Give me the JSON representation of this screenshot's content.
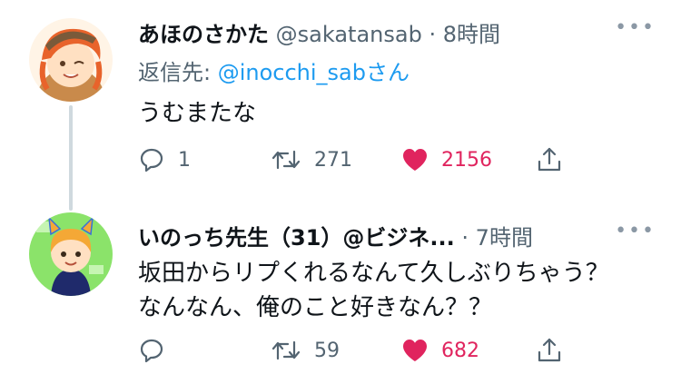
{
  "tweets": [
    {
      "name": "あほのさかた",
      "handle": "@sakatansab",
      "dot": "·",
      "time": "8時間",
      "reply_prefix": "返信先: ",
      "reply_mention": "@inocchi_sab",
      "reply_suffix": "さん",
      "text": "うむまたな",
      "replies": "1",
      "retweets": "271",
      "likes": "2156",
      "liked": true
    },
    {
      "name": "いのっち先生（31）@ビジネ...",
      "dot": "·",
      "time": "7時間",
      "text_line1": "坂田からリプくれるなんて久しぶりちゃう？",
      "text_line2": "なんなん、俺のこと好きなん？？",
      "replies": "",
      "retweets": "59",
      "likes": "682",
      "liked": true
    }
  ],
  "colors": {
    "like": "#e0245e",
    "mention": "#1d9bf0",
    "muted": "#536471"
  },
  "icons": [
    "reply-icon",
    "retweet-icon",
    "heart-icon",
    "share-icon",
    "more-icon"
  ]
}
